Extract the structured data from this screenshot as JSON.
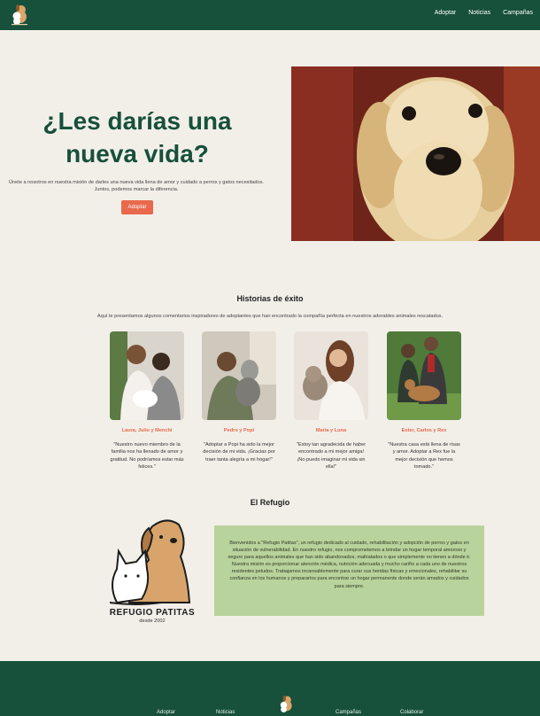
{
  "nav": {
    "items": [
      "Adoptar",
      "Noticias",
      "Campañas"
    ]
  },
  "hero": {
    "title": "¿Les darías una nueva vida?",
    "text": "Únete a nosotros en nuestra misión de darles una nueva vida llena de amor y cuidado a perros y gatos necesitados. Juntos, podemos marcar la diferencia.",
    "button": "Adoptar"
  },
  "stories": {
    "title": "Historias de éxito",
    "intro": "Aquí te presentamos algunos comentarios inspiradores de adoptantes que han encontrado la compañía perfecta en nuestros adorables animales rescatados.",
    "items": [
      {
        "name": "Laura, Julio y Menchi",
        "quote": "\"Nuestro nuevo miembro de la familia nos ha llenado de amor y gratitud. No podríamos estar más felices.\""
      },
      {
        "name": "Pedro y Popi",
        "quote": "\"Adoptar a Popi ha sido la mejor decisión de mi vida. ¡Gracias por traer tanta alegría a mi hogar!\""
      },
      {
        "name": "María y Luna",
        "quote": "\"Estoy tan agradecida de haber encontrado a mi mejor amiga! ¡No puedo imaginar mi vida sin ella!\""
      },
      {
        "name": "Ester, Carlos y Rex",
        "quote": "\"Nuestra casa está llena de risas y amor. Adoptar a Rex fue la mejor decisión que hemos tomado.\""
      }
    ]
  },
  "refugio": {
    "title": "El Refugio",
    "logo_name": "REFUGIO PATITAS",
    "since": "desde 2002",
    "text": "Bienvenidos a \"Refugio Patitas\", un refugio dedicado al cuidado, rehabilitación y adopción de perros y gatos en situación de vulnerabilidad. En nuestro refugio, nos comprometemos a brindar un hogar temporal amoroso y seguro para aquellos animales que han sido abandonados, maltratados o que simplemente no tienen a dónde ir. Nuestra misión es proporcionar atención médica, nutrición adecuada y mucho cariño a cada uno de nuestros residentes peludos. Trabajamos incansablemente para curar sus heridas físicas y emocionales, rehabilitar su confianza en los humanos y prepararlos para encontrar un hogar permanente donde serán amados y cuidados para siempre."
  },
  "footer": {
    "links": [
      "Adoptar",
      "Noticias",
      "Campañas",
      "Colaborar"
    ]
  },
  "colors": {
    "brand": "#17503b",
    "accent": "#e8694c",
    "panel": "#b9d39c",
    "background": "#f2efe9"
  }
}
